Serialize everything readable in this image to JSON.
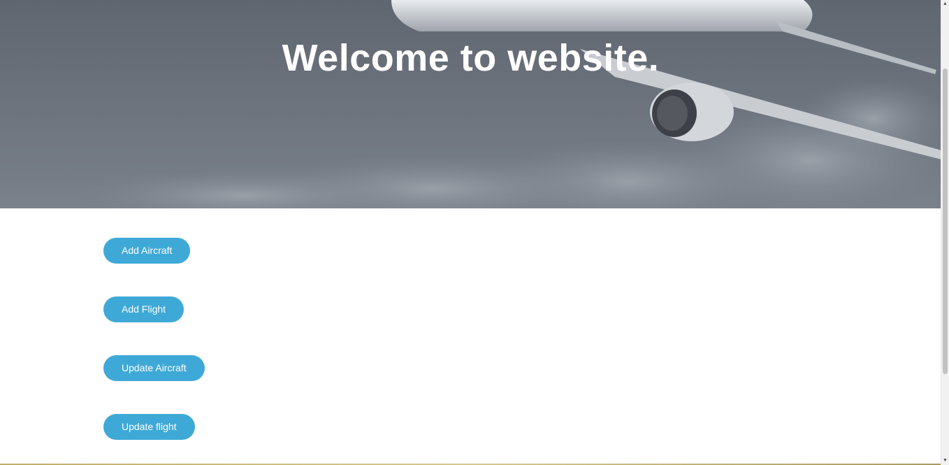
{
  "hero": {
    "title": "Welcome to website."
  },
  "actions": {
    "add_aircraft": "Add Aircraft",
    "add_flight": "Add Flight",
    "update_aircraft": "Update Aircraft",
    "update_flight": "Update flight"
  },
  "colors": {
    "button_bg": "#3ea9d6",
    "button_text": "#ffffff",
    "hero_overlay": "#5f6670"
  }
}
